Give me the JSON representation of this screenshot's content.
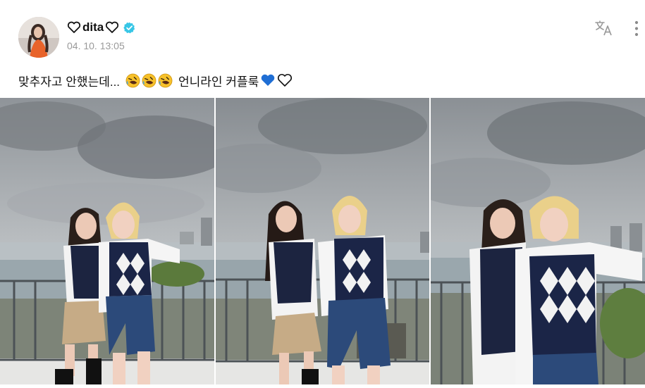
{
  "post": {
    "author_name": "dita",
    "timestamp": "04. 10. 13:05",
    "caption_text": "맞추자고 안했는데...",
    "caption_text_2": "언니라인 커플룩"
  },
  "icons": {
    "verified": "verified-badge-icon",
    "translate": "translate-icon",
    "more": "more-vertical-icon",
    "emoji": "rolling-on-floor-laughing-emoji",
    "blue_heart": "blue-heart-emoji",
    "white_heart": "white-heart-emoji"
  },
  "colors": {
    "verified": "#37c6e6",
    "blue_heart": "#1f6ed4",
    "timestamp": "#9a9a9a"
  },
  "gallery": {
    "photo_count": 3
  }
}
